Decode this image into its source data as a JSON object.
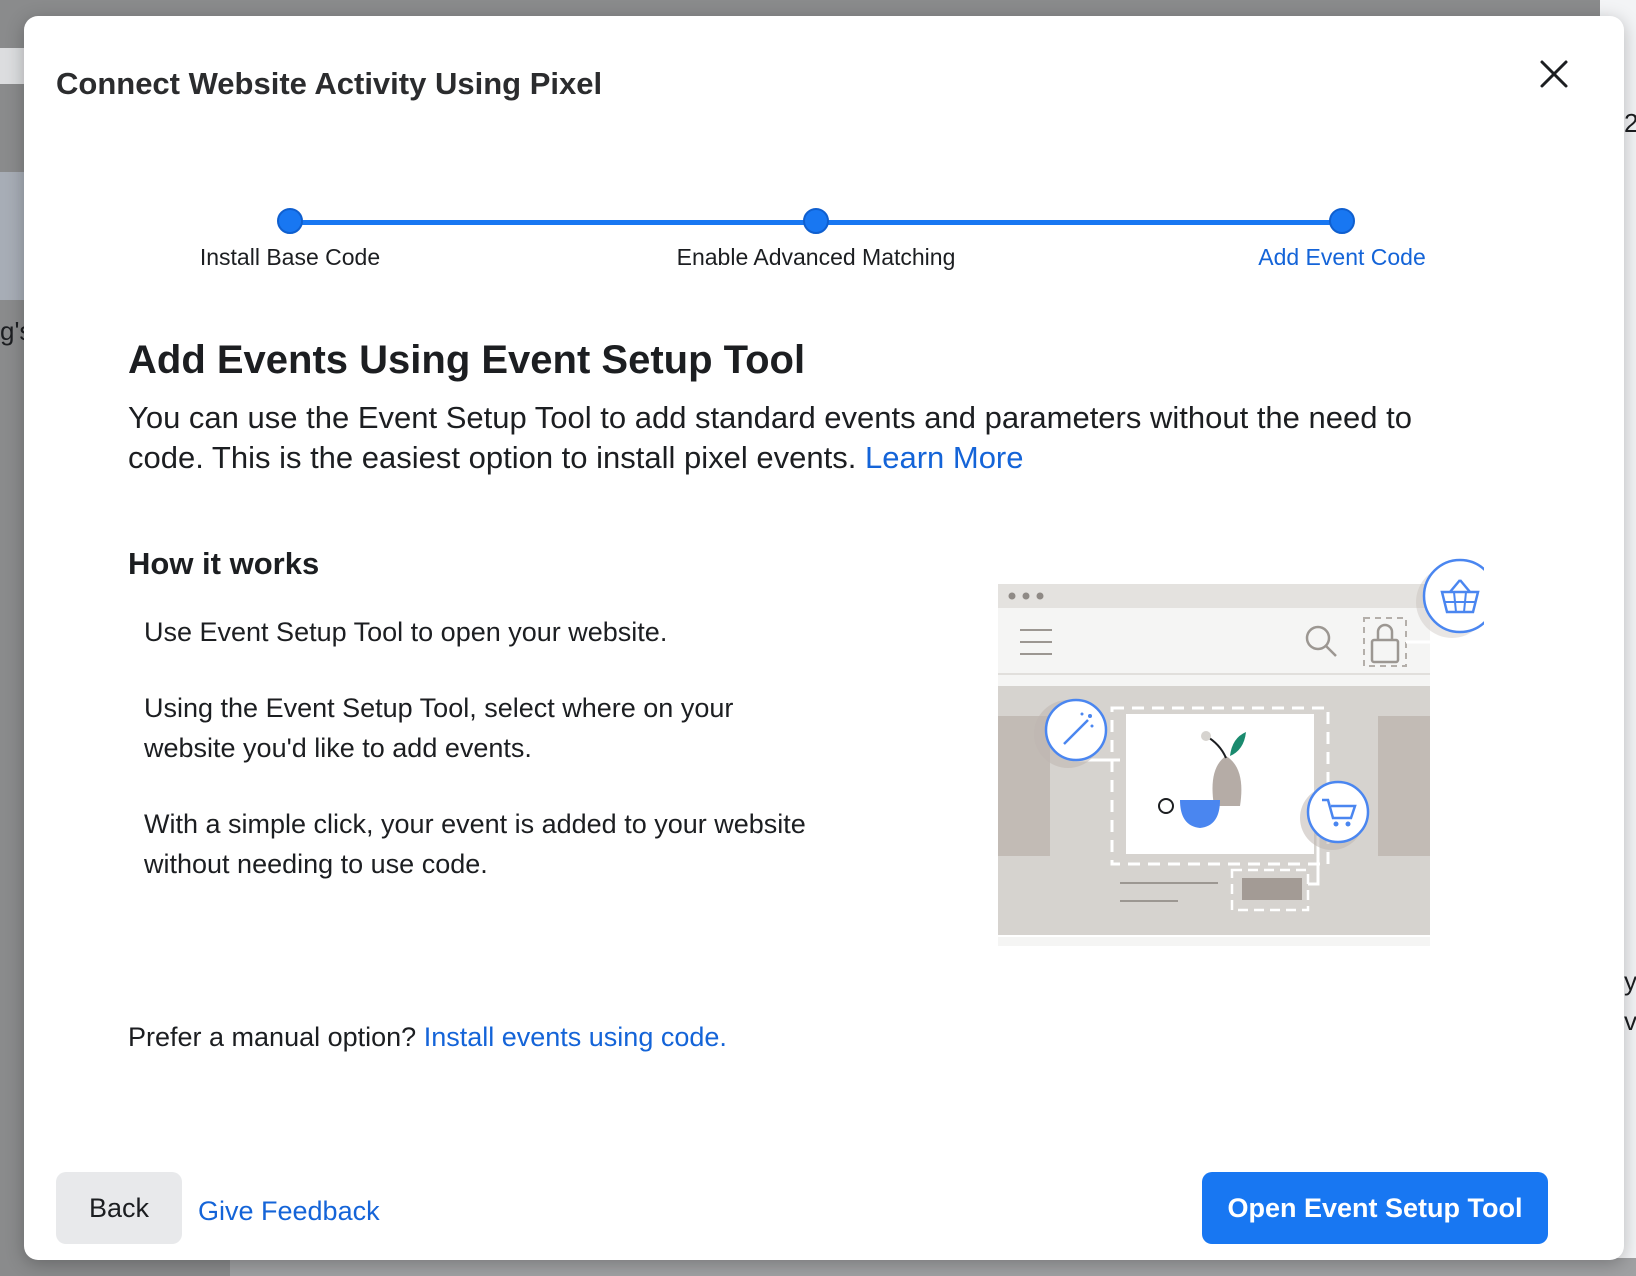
{
  "background": {
    "left_text": "g's",
    "right_text_top": "2",
    "right_text_mid": "y",
    "right_text_bottom": "v"
  },
  "modal": {
    "title": "Connect Website Activity Using Pixel",
    "close_icon": "close-icon"
  },
  "stepper": {
    "steps": [
      {
        "label": "Install Base Code",
        "state": "completed"
      },
      {
        "label": "Enable Advanced Matching",
        "state": "completed"
      },
      {
        "label": "Add Event Code",
        "state": "active"
      }
    ]
  },
  "content": {
    "heading": "Add Events Using Event Setup Tool",
    "description": "You can use the Event Setup Tool to add standard events and parameters without the need to code. This is the easiest option to install pixel events.",
    "learn_more": "Learn More",
    "how_heading": "How it works",
    "how_steps": [
      "Use Event Setup Tool to open your website.",
      "Using the Event Setup Tool, select where on your website you'd like to add events.",
      "With a simple click, your event is added to your website without needing to use code."
    ],
    "manual_prefix": "Prefer a manual option?",
    "manual_link": "Install events using code."
  },
  "footer": {
    "back": "Back",
    "feedback": "Give Feedback",
    "primary": "Open Event Setup Tool"
  },
  "colors": {
    "accent": "#1877f2",
    "link": "#1464d8",
    "illustration_gray": "#d6d3cf"
  }
}
